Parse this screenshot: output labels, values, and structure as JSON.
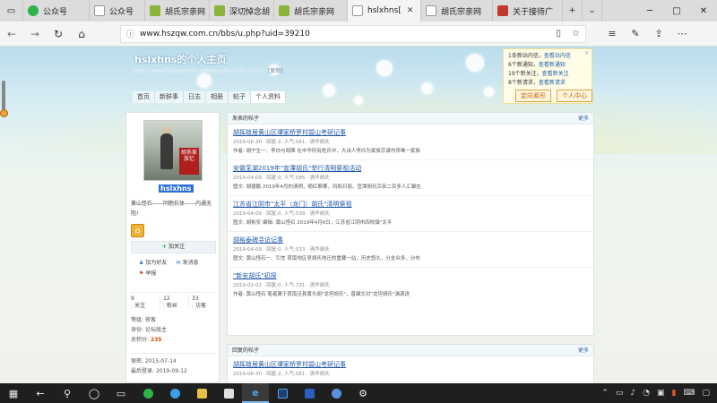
{
  "browser": {
    "tabs": [
      {
        "label": "公众号",
        "icon": "wechat-green-icon",
        "color": "#2fb24a",
        "active": false
      },
      {
        "label": "公众号",
        "icon": "page-icon",
        "color": "#ffffff",
        "active": false
      },
      {
        "label": "胡氏宗亲网",
        "icon": "site-icon",
        "color": "#8bb43b",
        "active": false
      },
      {
        "label": "深切悼念胡",
        "icon": "site-icon",
        "color": "#8bb43b",
        "active": false
      },
      {
        "label": "胡氏宗亲网",
        "icon": "site-icon",
        "color": "#8bb43b",
        "active": false
      },
      {
        "label": "hslxhns[",
        "icon": "page-icon",
        "color": "#ffffff",
        "active": true
      },
      {
        "label": "胡氏宗亲网",
        "icon": "page-icon",
        "color": "#ffffff",
        "active": false
      },
      {
        "label": "关于接待广",
        "icon": "site-icon",
        "color": "#c0392b",
        "active": false
      }
    ],
    "url": "www.hszqw.com.cn/bbs/u.php?uid=39210"
  },
  "page": {
    "site_title": "hslxhns的个人主页",
    "site_url": "http://www.hszqw.com.cn/bbs/u.php?uid=39210",
    "copy_label": "[复制]",
    "nav": [
      "首页",
      "新鲜事",
      "日志",
      "相册",
      "帖子",
      "个人资料"
    ],
    "notify": {
      "lines": [
        {
          "text": "1条新站内信，",
          "link": "查看站内信"
        },
        {
          "text": "6个新通知，",
          "link": "查看新通知"
        },
        {
          "text": "19个新关注，",
          "link": "查看新关注"
        },
        {
          "text": "8个新请求，",
          "link": "查看新请求"
        }
      ]
    },
    "user_buttons": [
      "定向紧形",
      "个人中心"
    ],
    "profile": {
      "avatar_tag": "胡系家族忆",
      "username": "hslxhns",
      "motto": "黄山怪石——同胞抗体——内通无阻!",
      "follow_label": "加关注",
      "actions": [
        [
          "加为好友",
          "发消息"
        ],
        [
          "举报"
        ]
      ],
      "stats": [
        {
          "num": "9",
          "label": "关注"
        },
        {
          "num": "12",
          "label": "粉丝"
        },
        {
          "num": "33",
          "label": "访客"
        }
      ],
      "info": [
        {
          "k": "等级:",
          "v": "侠客"
        },
        {
          "k": "身份:",
          "v": "论坛版主"
        },
        {
          "k": "总积分:",
          "v": "235"
        }
      ],
      "info2": [
        {
          "k": "保密,",
          "v": "2015-07-14"
        },
        {
          "k": "最后登录:",
          "v": "2019-09-12"
        }
      ]
    },
    "posts_panel": {
      "title": "发表的帖子",
      "more": "更多",
      "posts": [
        {
          "title": "胡挥故居黄山区谭家桥罗村碧山考研记事",
          "meta": "2019-06-30 · 回复:2, 人气:561 · 清华胡氏",
          "summary": "作者: 胡宁生一、李白与胡茜    在中华所有姓氏中，大诗人李白为家族宗谱作序唯一家族"
        },
        {
          "title": "安徽芜湖2019年\"宣潭胡氏\"举行清明祭祖活动",
          "meta": "2019-04-09 · 回复:0, 人气:585 · 清华胡氏",
          "summary": "图文: 胡德鹏    2019年4月的清明，随红聊哪、风和日丽，宣潭胡氏宗亲二百多人汇聚在"
        },
        {
          "title": "江苏省江阴市\"太平（龙门）胡氏\"清明祭祖",
          "meta": "2019-04-09 · 回复:0, 人气:539 · 清华胡氏",
          "summary": "图文: 胡彬安  编辑: 黄山怪石    2019年4月6日，江苏省江阴市四校镇\"太平"
        },
        {
          "title": "胡裕泰碑寻访记事",
          "meta": "2019-04-09 · 回复:0, 人气:533 · 清华胡氏",
          "summary": "图文: 黄山怪石一、引言    荷南地区皂胡氏地迁的重要一站，历史悠久，分支众多，分布"
        },
        {
          "title": "\"新安胡氏\"初探",
          "meta": "2019-02-02 · 回复:0, 人气:731 · 清华胡氏",
          "summary": "作者: 黄山怪石    笔者翼于荷南泾县黄头胡\"龙坦胡氏\"，曾编文对\"龙坦胡氏\"渊源进"
        }
      ]
    },
    "replies_panel": {
      "title": "回复的帖子",
      "more": "更多",
      "posts": [
        {
          "title": "胡挥故居黄山区谭家桥罗村碧山考研记事",
          "meta": "2019-06-30 · 回复:2, 人气:561 · 清华胡氏"
        }
      ]
    }
  },
  "colors": {
    "link": "#1f56a8",
    "accent_orange": "#e04a00",
    "taskbar": "#1f1f1f"
  }
}
